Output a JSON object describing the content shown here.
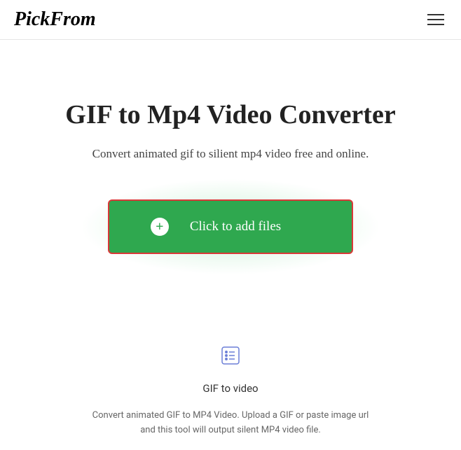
{
  "header": {
    "logo": "PickFrom"
  },
  "main": {
    "title": "GIF to Mp4 Video Converter",
    "subtitle": "Convert animated gif to silient mp4 video free and online.",
    "upload_button_label": "Click to add files"
  },
  "feature": {
    "title": "GIF to video",
    "description_line1": "Convert animated GIF to MP4 Video. Upload a GIF or paste image url",
    "description_line2": "and this tool will output silent MP4 video file."
  }
}
